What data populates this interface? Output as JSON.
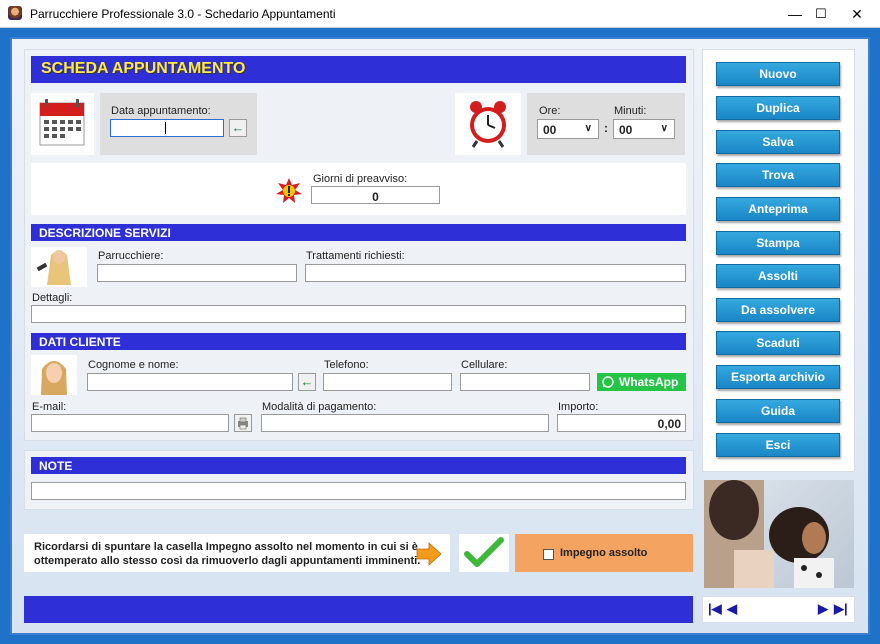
{
  "window": {
    "title": "Parrucchiere Professionale 3.0 - Schedario Appuntamenti",
    "min": "—",
    "max": "☐",
    "close": "✕"
  },
  "header": {
    "title": "SCHEDA APPUNTAMENTO"
  },
  "appointment": {
    "date_label": "Data appuntamento:",
    "date_value": "",
    "hours_label": "Ore:",
    "hours_value": "00",
    "minutes_label": "Minuti:",
    "minutes_value": "00",
    "separator": ":",
    "notice_label": "Giorni di preavviso:",
    "notice_value": "0",
    "arrow": "←"
  },
  "services": {
    "title": "DESCRIZIONE SERVIZI",
    "hairdresser_label": "Parrucchiere:",
    "treatments_label": "Trattamenti richiesti:",
    "details_label": "Dettagli:"
  },
  "client": {
    "title": "DATI CLIENTE",
    "name_label": "Cognome e nome:",
    "phone_label": "Telefono:",
    "mobile_label": "Cellulare:",
    "whatsapp_label": "WhatsApp",
    "email_label": "E-mail:",
    "payment_label": "Modalità di pagamento:",
    "amount_label": "Importo:",
    "amount_value": "0,00"
  },
  "notes": {
    "title": "NOTE"
  },
  "reminder": {
    "text": "Ricordarsi di spuntare la casella Impegno assolto nel momento in cui si è ottemperato allo stesso così da rimuoverlo dagli appuntamenti imminenti.",
    "checkbox_label": "Impegno assolto"
  },
  "actions": [
    "Nuovo",
    "Duplica",
    "Salva",
    "Trova",
    "Anteprima",
    "Stampa",
    "Assolti",
    "Da assolvere",
    "Scaduti",
    "Esporta archivio",
    "Guida",
    "Esci"
  ],
  "pager": {
    "first": "|◀",
    "prev": "◀",
    "next": "▶",
    "last": "▶|"
  },
  "colors": {
    "accent_bar": "#2f2fd7",
    "button": "#1a86c6",
    "whatsapp": "#25c447",
    "checkbox_panel": "#f4a460"
  }
}
